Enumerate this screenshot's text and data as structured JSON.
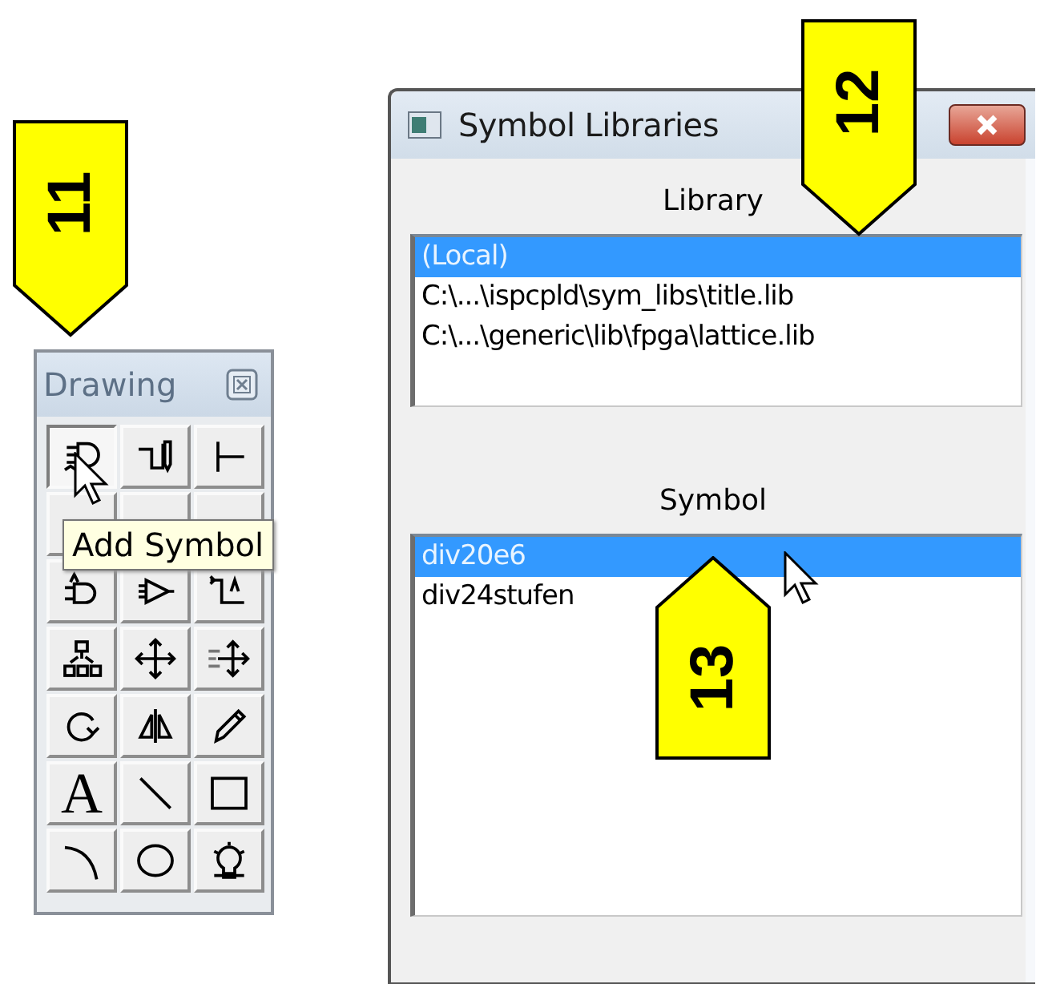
{
  "callouts": [
    {
      "number": "11",
      "kind": "downward"
    },
    {
      "number": "12",
      "kind": "downward"
    },
    {
      "number": "13",
      "kind": "upward"
    }
  ],
  "toolbar": {
    "title": "Drawing",
    "tooltip": "Add Symbol",
    "tools": [
      {
        "kind": "icon",
        "pressed": true
      },
      {
        "kind": "icon",
        "pressed": false
      },
      {
        "kind": "icon",
        "pressed": false
      },
      {
        "kind": "hidden",
        "pressed": false
      },
      {
        "kind": "hidden",
        "pressed": false
      },
      {
        "kind": "hidden",
        "pressed": false
      },
      {
        "kind": "icon",
        "pressed": false
      },
      {
        "kind": "icon",
        "pressed": false
      },
      {
        "kind": "icon",
        "pressed": false
      },
      {
        "kind": "icon",
        "pressed": false
      },
      {
        "kind": "icon",
        "pressed": false
      },
      {
        "kind": "icon",
        "pressed": false
      },
      {
        "kind": "icon",
        "pressed": false
      },
      {
        "kind": "icon",
        "pressed": false
      },
      {
        "kind": "icon",
        "pressed": false
      },
      {
        "kind": "glyph",
        "text": "A",
        "pressed": false
      },
      {
        "kind": "icon",
        "pressed": false
      },
      {
        "kind": "icon",
        "pressed": false
      },
      {
        "kind": "icon",
        "pressed": false
      },
      {
        "kind": "icon",
        "pressed": false
      },
      {
        "kind": "icon",
        "pressed": false
      }
    ]
  },
  "dialog": {
    "title": "Symbol Libraries",
    "library": {
      "label": "Library",
      "items": [
        {
          "text": "(Local)",
          "selected": true
        },
        {
          "text": "C:\\...\\ispcpld\\sym_libs\\title.lib",
          "selected": false
        },
        {
          "text": "C:\\...\\generic\\lib\\fpga\\lattice.lib",
          "selected": false
        }
      ]
    },
    "symbol": {
      "label": "Symbol",
      "items": [
        {
          "text": "div20e6",
          "selected": true
        },
        {
          "text": "div24stufen",
          "selected": false
        }
      ]
    }
  }
}
